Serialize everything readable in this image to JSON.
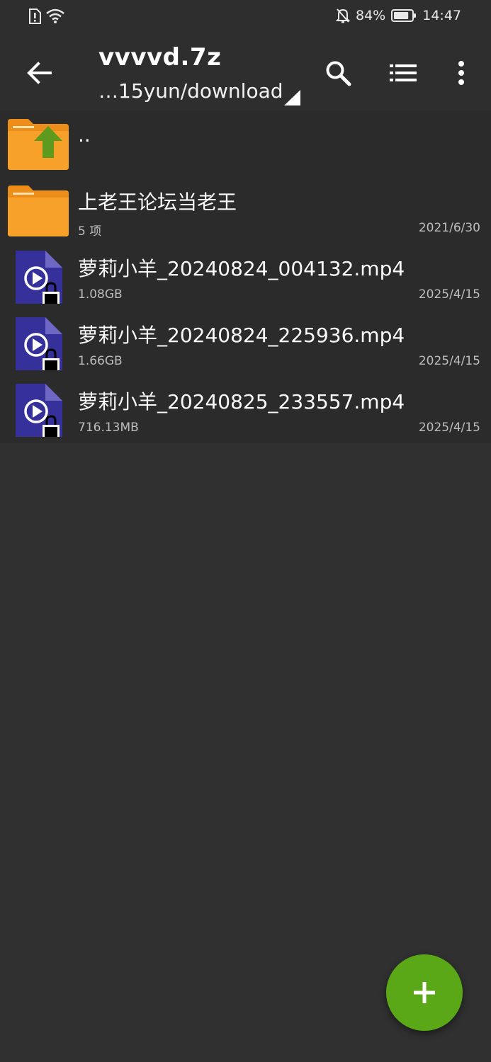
{
  "status_bar": {
    "battery_percent_label": "84%",
    "battery_level": 0.84,
    "time": "14:47",
    "icons": [
      "sim-alert-icon",
      "wifi-icon",
      "notifications-off-icon",
      "battery-icon"
    ]
  },
  "app_bar": {
    "title": "vvvvd.7z",
    "path": "…15yun/download",
    "icons": [
      "back-arrow-icon",
      "search-icon",
      "list-view-icon",
      "more-vert-icon",
      "dropdown-triangle-icon"
    ]
  },
  "files": [
    {
      "type": "parent",
      "name": "..",
      "meta": "",
      "date": "",
      "icon": "folder-up-icon"
    },
    {
      "type": "folder",
      "name": "上老王论坛当老王",
      "meta": "5 项",
      "date": "2021/6/30",
      "icon": "folder-icon"
    },
    {
      "type": "video",
      "name": "萝莉小羊_20240824_004132.mp4",
      "meta": "1.08GB",
      "date": "2025/4/15",
      "icon": "locked-video-file-icon"
    },
    {
      "type": "video",
      "name": "萝莉小羊_20240824_225936.mp4",
      "meta": "1.66GB",
      "date": "2025/4/15",
      "icon": "locked-video-file-icon"
    },
    {
      "type": "video",
      "name": "萝莉小羊_20240825_233557.mp4",
      "meta": "716.13MB",
      "date": "2025/4/15",
      "icon": "locked-video-file-icon"
    }
  ],
  "fab": {
    "icon": "plus-icon"
  },
  "colors": {
    "background": "#303030",
    "list_background": "#2b2b2b",
    "folder": "#f7a12a",
    "folder_up_arrow": "#5e9a1e",
    "video_file": "#35309a",
    "fab": "#5aa818"
  }
}
